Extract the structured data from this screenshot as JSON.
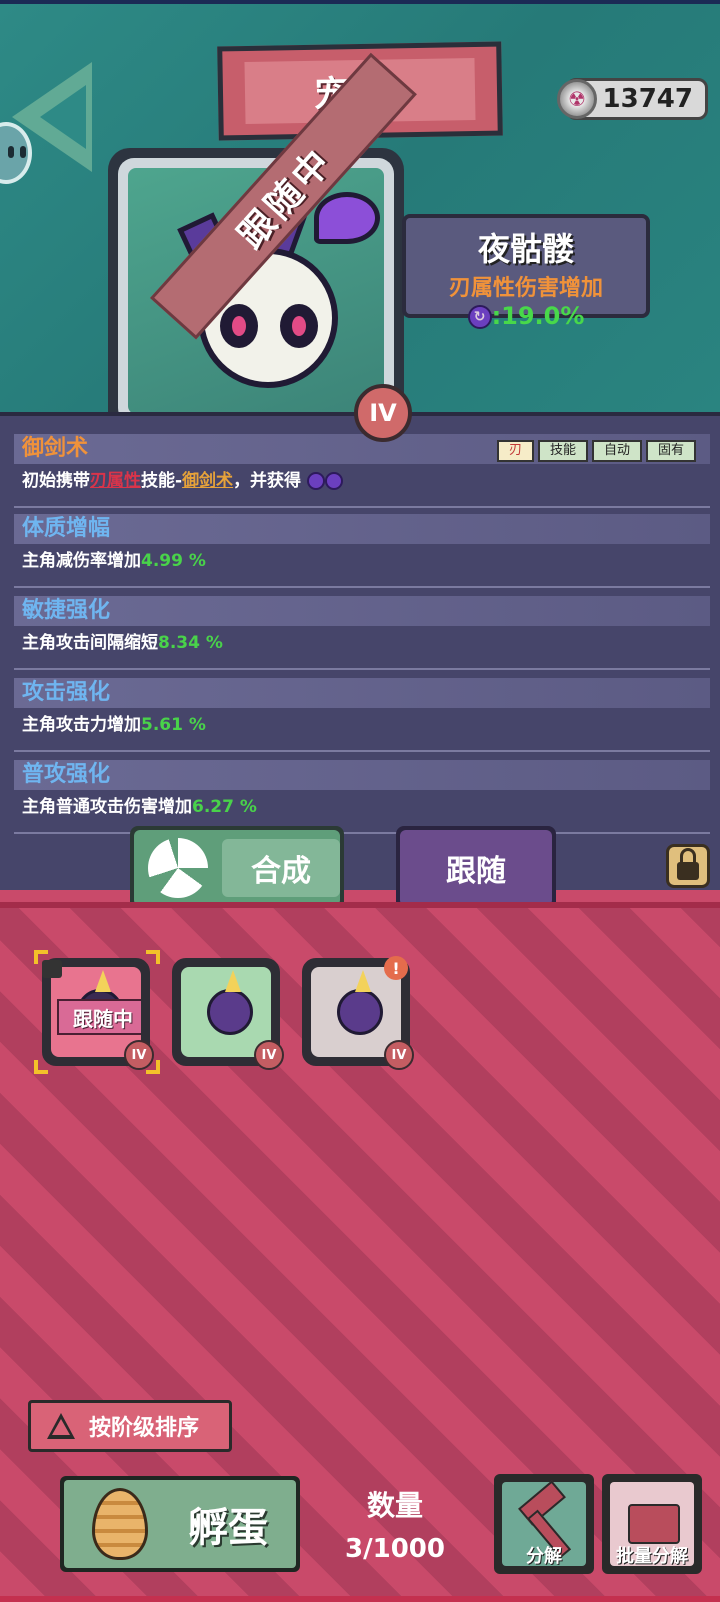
{
  "header": {
    "title": "宠物",
    "coins": "13747"
  },
  "pet": {
    "name": "夜骷髅",
    "bonus_desc": "刃属性伤害增加",
    "bonus_value": ":19.0%",
    "status_ribbon": "跟随中",
    "tier": "IV"
  },
  "skills": [
    {
      "title": "御剑术",
      "desc_pre": "初始携带",
      "desc_red": "刃属性",
      "desc_mid": "技能-",
      "desc_gold": "御剑术",
      "desc_post": "，并获得",
      "tags": [
        "刃",
        "技能",
        "自动",
        "固有"
      ],
      "title_color": "#f0923a"
    },
    {
      "title": "体质增幅",
      "desc_pre": "主角减伤率增加",
      "value": "4.99 %",
      "title_color": "#6fb5f0"
    },
    {
      "title": "敏捷强化",
      "desc_pre": "主角攻击间隔缩短",
      "value": "8.34 %",
      "title_color": "#6fb5f0"
    },
    {
      "title": "攻击强化",
      "desc_pre": "主角攻击力增加",
      "value": "5.61 %",
      "title_color": "#6fb5f0"
    },
    {
      "title": "普攻强化",
      "desc_pre": "主角普通攻击伤害增加",
      "value": "6.27 %",
      "title_color": "#6fb5f0"
    }
  ],
  "actions": {
    "combine": "合成",
    "follow": "跟随"
  },
  "inventory": [
    {
      "status": "跟随中",
      "tier": "IV",
      "bg": "#e8748f",
      "locked": true,
      "selected": true
    },
    {
      "tier": "IV",
      "bg": "#a9d9b0"
    },
    {
      "tier": "IV",
      "bg": "#d9cfcf",
      "alert": "!"
    }
  ],
  "footer": {
    "sort_label": "按阶级排序",
    "hatch_label": "孵蛋",
    "count_title": "数量",
    "count_value": "3/1000",
    "decompose": "分解",
    "batch_decompose": "批量分解"
  }
}
